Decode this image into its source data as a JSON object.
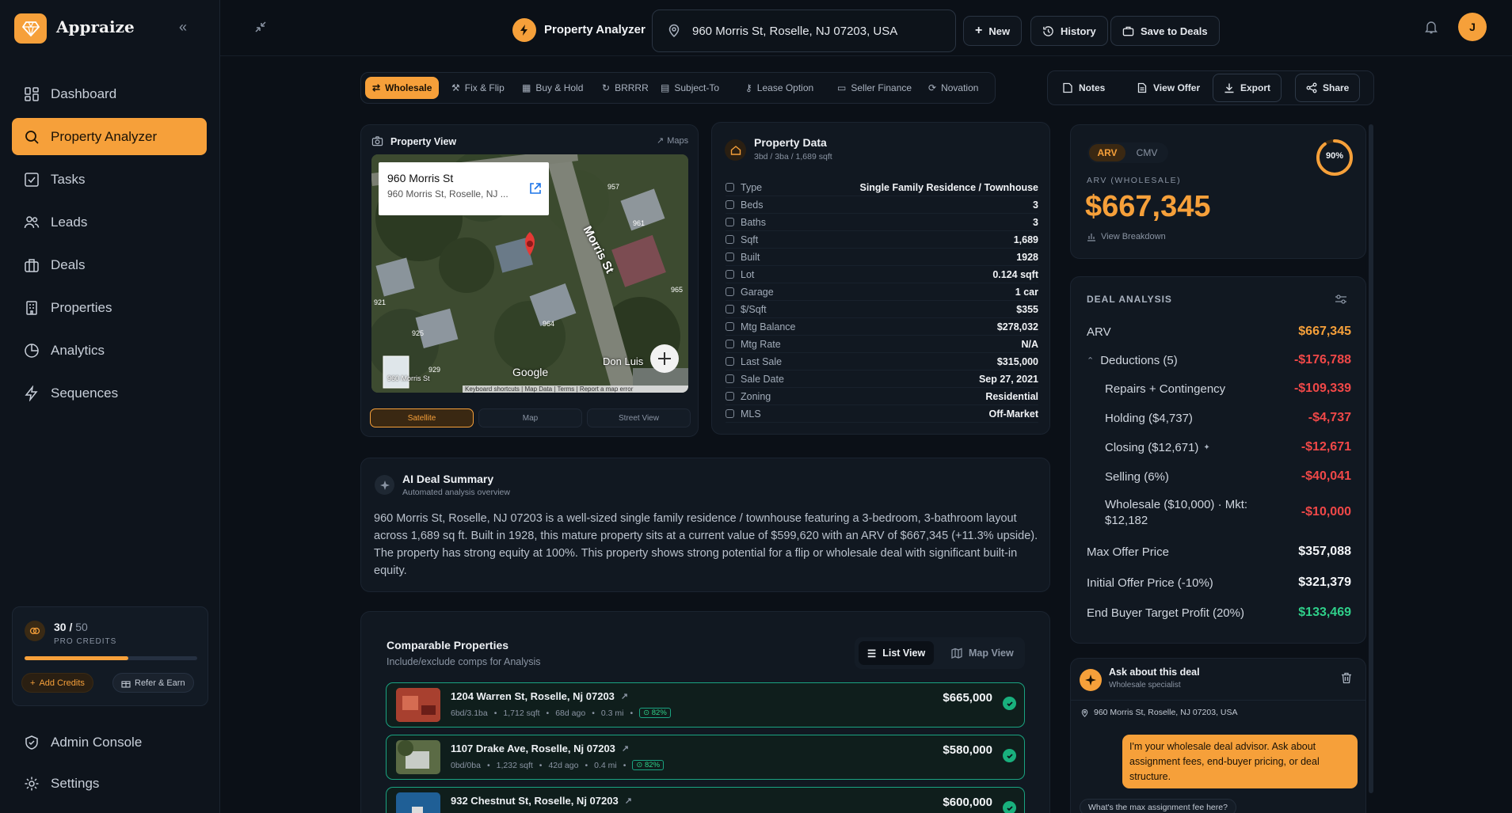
{
  "app": {
    "name": "Appraize"
  },
  "sidebar": {
    "items": [
      {
        "label": "Dashboard",
        "icon": "dashboard-icon"
      },
      {
        "label": "Property Analyzer",
        "icon": "search-icon"
      },
      {
        "label": "Tasks",
        "icon": "tasks-icon"
      },
      {
        "label": "Leads",
        "icon": "users-icon"
      },
      {
        "label": "Deals",
        "icon": "briefcase-icon"
      },
      {
        "label": "Properties",
        "icon": "building-icon"
      },
      {
        "label": "Analytics",
        "icon": "pie-chart-icon"
      },
      {
        "label": "Sequences",
        "icon": "lightning-icon"
      }
    ],
    "active": "Property Analyzer",
    "credits": {
      "used": "30",
      "total": "50",
      "label": "PRO CREDITS",
      "fraction": 0.6,
      "add_label": "Add Credits",
      "refer_label": "Refer & Earn"
    },
    "admin_label": "Admin Console",
    "settings_label": "Settings"
  },
  "topbar": {
    "title": "Property Analyzer",
    "address": "960 Morris St, Roselle, NJ 07203, USA",
    "new_label": "New",
    "history_label": "History",
    "save_label": "Save to Deals",
    "avatar_initial": "J"
  },
  "strategies": [
    "Wholesale",
    "Fix & Flip",
    "Buy & Hold",
    "BRRRR",
    "Subject-To",
    "Lease Option",
    "Seller Finance",
    "Novation"
  ],
  "active_strategy": "Wholesale",
  "actions": {
    "notes": "Notes",
    "view_offer": "View Offer",
    "export": "Export",
    "share": "Share"
  },
  "property_view": {
    "title": "Property View",
    "maps_link": "Maps",
    "popup_title": "960 Morris St",
    "popup_sub": "960 Morris St, Roselle, NJ ...",
    "street_label": "Morris St",
    "don_luis": "Don Luis",
    "google": "Google",
    "pin_label": "960 Morris St",
    "attribution": "Keyboard shortcuts | Map Data | Terms | Report a map error",
    "house_numbers": [
      "957",
      "961",
      "965",
      "921",
      "925",
      "929",
      "964"
    ],
    "view_tabs": [
      "Satellite",
      "Map",
      "Street View"
    ],
    "active_view": "Satellite"
  },
  "property_data": {
    "title": "Property Data",
    "subtitle": "3bd / 3ba / 1,689 sqft",
    "rows": [
      {
        "label": "Type",
        "value": "Single Family Residence / Townhouse",
        "icon": "home-icon"
      },
      {
        "label": "Beds",
        "value": "3",
        "icon": "bed-icon"
      },
      {
        "label": "Baths",
        "value": "3",
        "icon": "droplet-icon"
      },
      {
        "label": "Sqft",
        "value": "1,689",
        "icon": "ruler-icon"
      },
      {
        "label": "Built",
        "value": "1928",
        "icon": "calendar-icon"
      },
      {
        "label": "Lot",
        "value": "0.124 sqft",
        "icon": "pin-icon"
      },
      {
        "label": "Garage",
        "value": "1 car",
        "icon": "car-icon"
      },
      {
        "label": "$/Sqft",
        "value": "$355",
        "icon": "dollar-icon"
      },
      {
        "label": "Mtg Balance",
        "value": "$278,032",
        "icon": "bank-icon"
      },
      {
        "label": "Mtg Rate",
        "value": "N/A",
        "icon": "percent-icon"
      },
      {
        "label": "Last Sale",
        "value": "$315,000",
        "icon": "receipt-icon"
      },
      {
        "label": "Sale Date",
        "value": "Sep 27, 2021",
        "icon": "calendar-icon"
      },
      {
        "label": "Zoning",
        "value": "Residential",
        "icon": "grid-icon"
      },
      {
        "label": "MLS",
        "value": "Off-Market",
        "icon": "tag-icon"
      }
    ]
  },
  "ai_summary": {
    "title": "AI Deal Summary",
    "subtitle": "Automated analysis overview",
    "text": "960 Morris St, Roselle, NJ 07203 is a well-sized single family residence / townhouse featuring a 3-bedroom, 3-bathroom layout across 1,689 sq ft. Built in 1928, this mature property sits at a current value of $599,620 with an ARV of $667,345 (+11.3% upside). The property has strong equity at 100%. This property shows strong potential for a flip or wholesale deal with significant built-in equity."
  },
  "comps": {
    "title": "Comparable Properties",
    "subtitle": "Include/exclude comps for Analysis",
    "list_view": "List View",
    "map_view": "Map View",
    "items": [
      {
        "address": "1204 Warren St, Roselle, Nj 07203",
        "beds": "6bd/3.1ba",
        "sqft": "1,712 sqft",
        "age": "68d ago",
        "dist": "0.3 mi",
        "score": "82%",
        "price": "$665,000"
      },
      {
        "address": "1107 Drake Ave, Roselle, Nj 07203",
        "beds": "0bd/0ba",
        "sqft": "1,232 sqft",
        "age": "42d ago",
        "dist": "0.4 mi",
        "score": "82%",
        "price": "$580,000"
      },
      {
        "address": "932 Chestnut St, Roselle, Nj 07203",
        "beds": "",
        "sqft": "",
        "age": "",
        "dist": "",
        "score": "",
        "price": "$600,000"
      }
    ]
  },
  "arv": {
    "toggle": [
      "ARV",
      "CMV"
    ],
    "active": "ARV",
    "confidence": "90%",
    "confidence_fraction": 0.9,
    "label": "ARV (WHOLESALE)",
    "value": "$667,345",
    "breakdown": "View Breakdown"
  },
  "deal_analysis": {
    "title": "DEAL ANALYSIS",
    "arv_label": "ARV",
    "arv_value": "$667,345",
    "deductions_label": "Deductions (5)",
    "deductions_value": "-$176,788",
    "deductions": [
      {
        "label": "Repairs + Contingency",
        "value": "-$109,339"
      },
      {
        "label": "Holding ($4,737)",
        "value": "-$4,737"
      },
      {
        "label": "Closing ($12,671)",
        "value": "-$12,671"
      },
      {
        "label": "Selling (6%)",
        "value": "-$40,041"
      },
      {
        "label": "Wholesale ($10,000) · Mkt: $12,182",
        "value": "-$10,000"
      }
    ],
    "max_offer_label": "Max Offer Price",
    "max_offer_value": "$357,088",
    "initial_offer_label": "Initial Offer Price (-10%)",
    "initial_offer_value": "$321,379",
    "profit_label": "End Buyer Target Profit (20%)",
    "profit_value": "$133,469"
  },
  "chat": {
    "title": "Ask about this deal",
    "subtitle": "Wholesale specialist",
    "address": "960 Morris St, Roselle, NJ 07203, USA",
    "message": "I'm your wholesale deal advisor. Ask about assignment fees, end-buyer pricing, or deal structure.",
    "suggestion": "What's the max assignment fee here?"
  },
  "colors": {
    "accent": "#f6a03a",
    "positive": "#2fd08a",
    "negative": "#f04848",
    "background": "#0b1017"
  }
}
